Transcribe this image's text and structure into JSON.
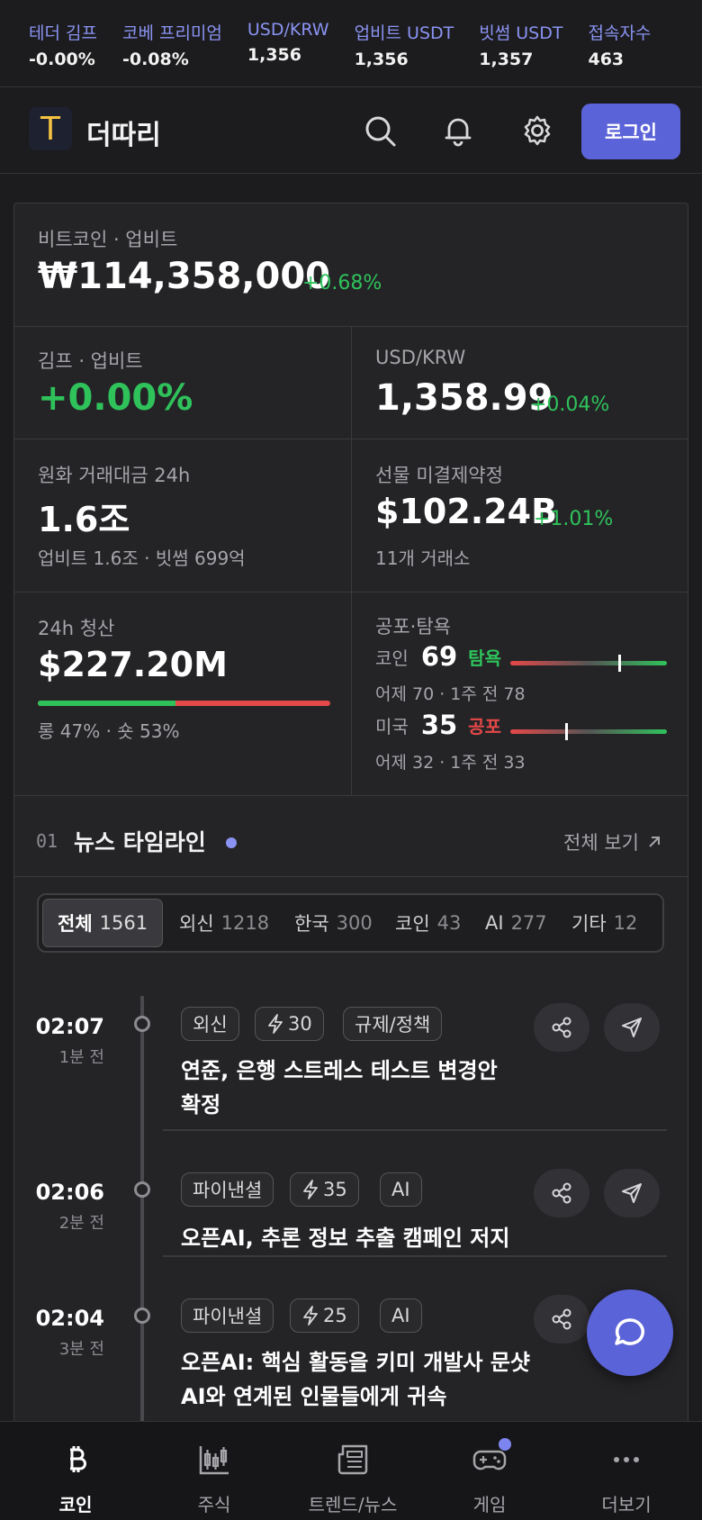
{
  "ticker": [
    {
      "label": "테더 김프",
      "value": "-0.00%"
    },
    {
      "label": "코베 프리미엄",
      "value": "-0.08%"
    },
    {
      "label": "USD/KRW",
      "value": "1,356"
    },
    {
      "label": "업비트 USDT",
      "value": "1,356"
    },
    {
      "label": "빗썸 USDT",
      "value": "1,357"
    },
    {
      "label": "접속자수",
      "value": "463"
    }
  ],
  "header": {
    "logo_letter": "T",
    "brand": "더따리",
    "login_label": "로그인"
  },
  "btc": {
    "label": "비트코인 · 업비트",
    "price": "₩114,358,000",
    "change": "+0.68%"
  },
  "kimp": {
    "label": "김프 · 업비트",
    "value": "+0.00%"
  },
  "usdkrw": {
    "label": "USD/KRW",
    "value": "1,358.99",
    "change": "+0.04%"
  },
  "krw_volume": {
    "label": "원화 거래대금 24h",
    "value": "1.6조",
    "sub": "업비트 1.6조 · 빗썸 699억"
  },
  "open_interest": {
    "label": "선물 미결제약정",
    "value": "$102.24B",
    "change": "+1.01%",
    "sub": "11개 거래소"
  },
  "liquidation": {
    "label": "24h 청산",
    "value": "$227.20M",
    "long_pct": 47,
    "sub": "롱 47% · 숏 53%"
  },
  "fear_greed": {
    "label": "공포·탐욕",
    "coin": {
      "name": "코인",
      "value": "69",
      "word": "탐욕",
      "sub": "어제 70 · 1주 전 78",
      "level": 0.69
    },
    "us": {
      "name": "미국",
      "value": "35",
      "word": "공포",
      "sub": "어제 32 · 1주 전 33",
      "level": 0.35
    }
  },
  "news": {
    "index": "01",
    "title": "뉴스 타임라인",
    "view_all": "전체 보기",
    "tabs": [
      {
        "label": "전체",
        "count": "1561"
      },
      {
        "label": "외신",
        "count": "1218"
      },
      {
        "label": "한국",
        "count": "300"
      },
      {
        "label": "코인",
        "count": "43"
      },
      {
        "label": "AI",
        "count": "277"
      },
      {
        "label": "기타",
        "count": "12"
      }
    ],
    "items": [
      {
        "time": "02:07",
        "ago": "1분 전",
        "source": "외신",
        "score": "30",
        "tag": "규제/정책",
        "title": "연준, 은행 스트레스 테스트 변경안 확정"
      },
      {
        "time": "02:06",
        "ago": "2분 전",
        "source": "파이낸셜",
        "score": "35",
        "tag": "AI",
        "title": "오픈AI, 추론 정보 추출 캠페인 저지"
      },
      {
        "time": "02:04",
        "ago": "3분 전",
        "source": "파이낸셜",
        "score": "25",
        "tag": "AI",
        "title": "오픈AI: 핵심 활동을 키미 개발사 문샷 AI와 연계된 인물들에게 귀속"
      }
    ]
  },
  "bottom_nav": [
    {
      "label": "코인",
      "icon": "bitcoin-icon"
    },
    {
      "label": "주식",
      "icon": "candlestick-icon"
    },
    {
      "label": "트렌드/뉴스",
      "icon": "newspaper-icon"
    },
    {
      "label": "게임",
      "icon": "gamepad-icon"
    },
    {
      "label": "더보기",
      "icon": "more-icon"
    }
  ],
  "colors": {
    "accent": "#5b63d8",
    "positive": "#2fc25b",
    "negative": "#e54848",
    "ticker_label": "#8a93f2"
  }
}
